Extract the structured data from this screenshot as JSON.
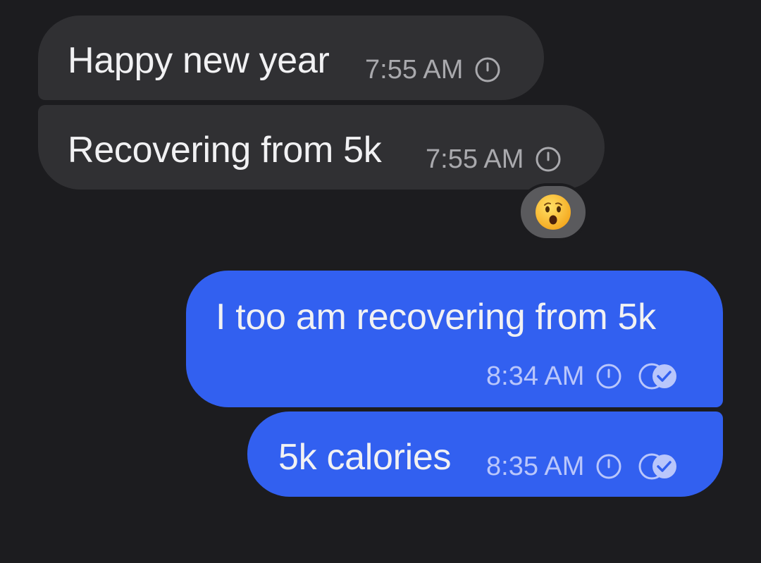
{
  "conversation": {
    "messages": [
      {
        "direction": "incoming",
        "text": "Happy new year",
        "time": "7:55 AM",
        "status_icon": "clock-icon"
      },
      {
        "direction": "incoming",
        "text": "Recovering from 5k",
        "time": "7:55 AM",
        "status_icon": "clock-icon",
        "reaction": {
          "emoji": "hushed-face",
          "icon": "hushed-face-emoji-icon"
        }
      },
      {
        "direction": "outgoing",
        "text": "I too am recovering from 5k",
        "time": "8:34 AM",
        "status_icon": "clock-icon",
        "delivery_icon": "read-receipt-icon"
      },
      {
        "direction": "outgoing",
        "text": "5k calories",
        "time": "8:35 AM",
        "status_icon": "clock-icon",
        "delivery_icon": "read-receipt-icon"
      }
    ]
  },
  "colors": {
    "background": "#1c1c1f",
    "incoming_bubble": "#303033",
    "outgoing_bubble": "#3260f0",
    "reaction_pill": "#5a5a5d"
  }
}
